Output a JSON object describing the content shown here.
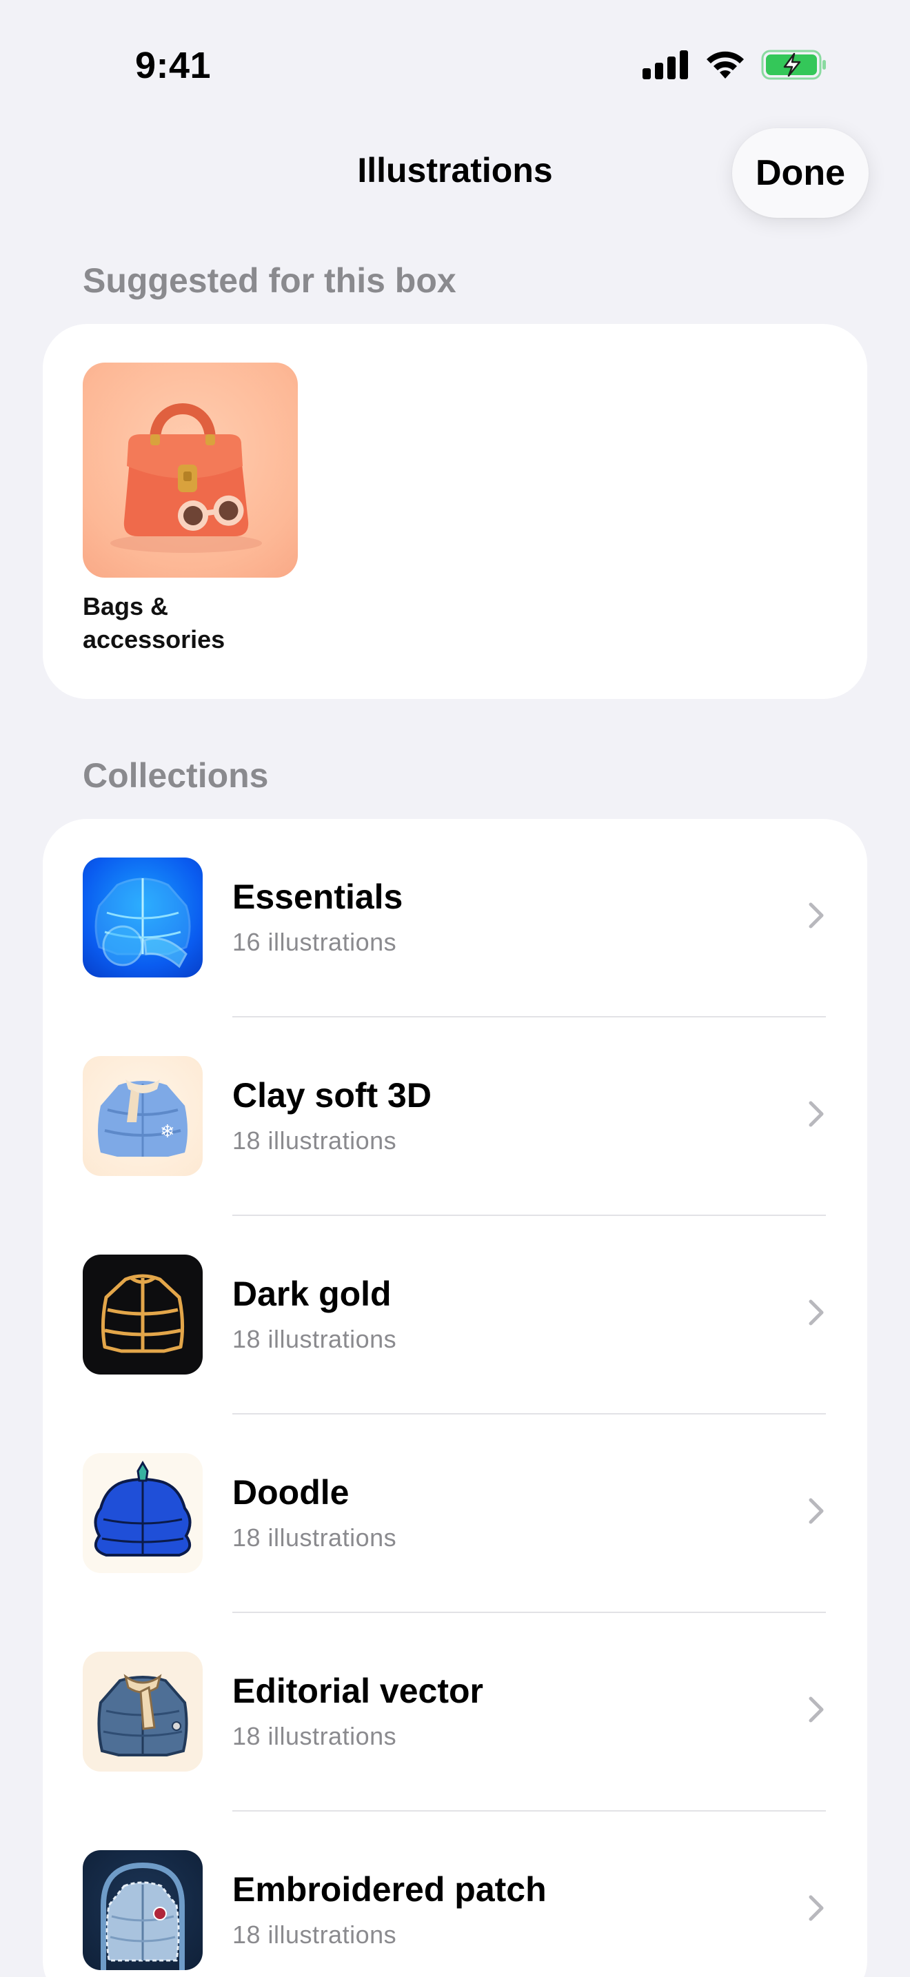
{
  "status_bar": {
    "time": "9:41"
  },
  "nav": {
    "title": "Illustrations",
    "done_label": "Done"
  },
  "suggested": {
    "header": "Suggested for this box",
    "item": {
      "label_line1": "Bags &",
      "label_line2": "accessories",
      "icon": "handbag-illustration"
    }
  },
  "collections": {
    "header": "Collections",
    "items": [
      {
        "title": "Essentials",
        "subtitle": "16 illustrations",
        "icon": "blue-wireframe-jacket"
      },
      {
        "title": "Clay soft 3D",
        "subtitle": "18 illustrations",
        "icon": "clay-puffer-jacket"
      },
      {
        "title": "Dark gold",
        "subtitle": "18 illustrations",
        "icon": "gold-outline-jacket"
      },
      {
        "title": "Doodle",
        "subtitle": "18 illustrations",
        "icon": "doodle-jacket"
      },
      {
        "title": "Editorial vector",
        "subtitle": "18 illustrations",
        "icon": "vector-jacket-scarf"
      },
      {
        "title": "Embroidered patch",
        "subtitle": "18 illustrations",
        "icon": "patch-jacket"
      }
    ]
  },
  "colors": {
    "background": "#f2f2f7",
    "card": "#ffffff",
    "secondary_text": "#8a8a8e",
    "battery_green": "#34c759"
  }
}
